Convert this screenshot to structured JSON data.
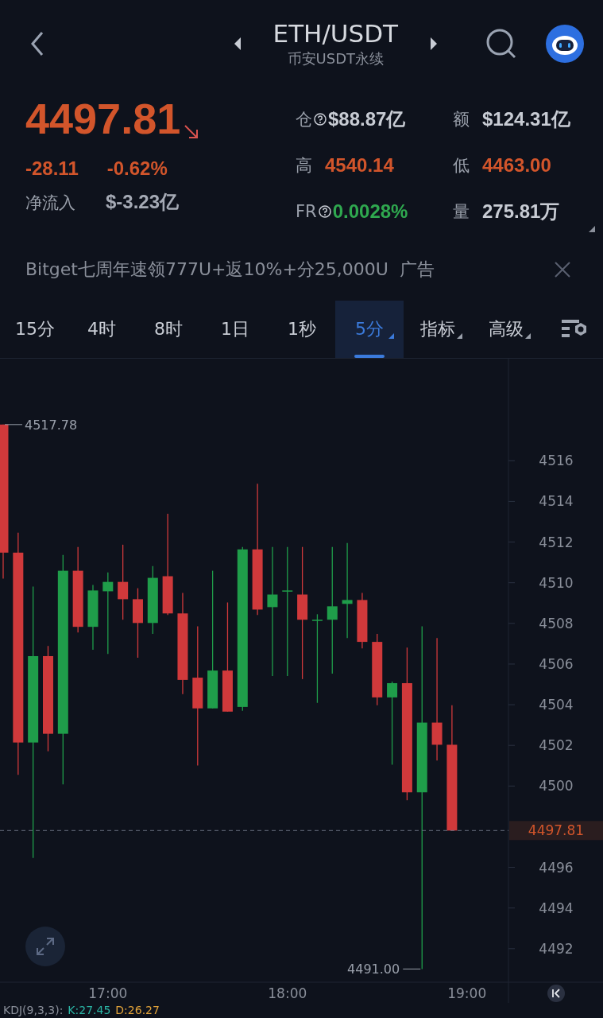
{
  "header": {
    "title": "ETH/USDT",
    "subtitle": "币安USDT永续"
  },
  "quote": {
    "price": "4497.81",
    "change": "-28.11",
    "change_pct": "-0.62%",
    "netflow_label": "净流入",
    "netflow": "$-3.23亿"
  },
  "stats": [
    {
      "label": "仓",
      "help": true,
      "value": "$88.87亿",
      "color": "#c8ccd4"
    },
    {
      "label": "额",
      "help": false,
      "value": "$124.31亿",
      "color": "#c8ccd4"
    },
    {
      "label": "高",
      "help": false,
      "value": "4540.14",
      "color": "#d2552b"
    },
    {
      "label": "低",
      "help": false,
      "value": "4463.00",
      "color": "#d2552b"
    },
    {
      "label": "FR",
      "help": true,
      "value": "0.0028%",
      "color": "#2fa84f"
    },
    {
      "label": "量",
      "help": false,
      "value": "275.81万",
      "color": "#c8ccd4"
    }
  ],
  "ad": {
    "text": "Bitget七周年速领777U+返10%+分25,000U",
    "tag": "广告"
  },
  "tabs": [
    {
      "label": "15分",
      "selected": false,
      "dropdown": false
    },
    {
      "label": "4时",
      "selected": false,
      "dropdown": false
    },
    {
      "label": "8时",
      "selected": false,
      "dropdown": false
    },
    {
      "label": "1日",
      "selected": false,
      "dropdown": false
    },
    {
      "label": "1秒",
      "selected": false,
      "dropdown": false
    },
    {
      "label": "5分",
      "selected": true,
      "dropdown": true
    },
    {
      "label": "指标",
      "selected": false,
      "dropdown": true
    },
    {
      "label": "高级",
      "selected": false,
      "dropdown": true
    }
  ],
  "chart": {
    "high_label": "4517.78",
    "low_label": "4491.00",
    "chart_data": {
      "type": "candlestick",
      "categories": [
        null,
        null,
        null,
        null,
        null,
        null,
        null,
        "17:00",
        null,
        null,
        null,
        null,
        null,
        null,
        null,
        null,
        null,
        null,
        null,
        "18:00",
        null,
        null,
        null,
        null,
        null,
        null,
        null,
        null,
        null,
        null,
        null,
        "19:00"
      ],
      "ohlc": [
        [
          4517.78,
          4517.78,
          4510.2,
          4511.48
        ],
        [
          4511.48,
          4512.46,
          4500.55,
          4502.14
        ],
        [
          4502.14,
          4509.81,
          4496.46,
          4506.39
        ],
        [
          4506.39,
          4506.89,
          4501.71,
          4502.57
        ],
        [
          4502.57,
          4511.37,
          4500.08,
          4510.59
        ],
        [
          4510.59,
          4511.76,
          4507.55,
          4507.83
        ],
        [
          4507.83,
          4509.89,
          4506.7,
          4509.62
        ],
        [
          4509.58,
          4510.51,
          4506.5,
          4510.04
        ],
        [
          4510.04,
          4511.87,
          4508.18,
          4509.19
        ],
        [
          4509.19,
          4509.73,
          4506.31,
          4508.02
        ],
        [
          4508.02,
          4510.82,
          4507.48,
          4510.24
        ],
        [
          4510.32,
          4513.39,
          4508.41,
          4508.49
        ],
        [
          4508.49,
          4509.5,
          4504.52,
          4505.22
        ],
        [
          4505.33,
          4507.86,
          4501.01,
          4503.82
        ],
        [
          4503.82,
          4510.59,
          4503.82,
          4505.68
        ],
        [
          4505.68,
          4509.03,
          4503.66,
          4503.66
        ],
        [
          4503.89,
          4511.76,
          4503.7,
          4511.64
        ],
        [
          4511.64,
          4514.87,
          4508.41,
          4508.68
        ],
        [
          4508.8,
          4511.76,
          4505.41,
          4509.42
        ],
        [
          4509.62,
          4511.76,
          4505.41,
          4509.62
        ],
        [
          4509.42,
          4511.76,
          4505.26,
          4508.18
        ],
        [
          4508.18,
          4508.45,
          4504.09,
          4508.18
        ],
        [
          4508.18,
          4511.76,
          4505.53,
          4508.84
        ],
        [
          4508.96,
          4511.95,
          4507.28,
          4509.15
        ],
        [
          4509.15,
          4509.5,
          4506.77,
          4507.09
        ],
        [
          4507.09,
          4507.48,
          4503.97,
          4504.36
        ],
        [
          4504.36,
          4505.14,
          4501.05,
          4505.06
        ],
        [
          4505.06,
          4506.81,
          4499.3,
          4499.69
        ],
        [
          4499.69,
          4507.86,
          4491.0,
          4503.12
        ],
        [
          4503.12,
          4507.28,
          4501.25,
          4502.03
        ],
        [
          4502.03,
          4503.97,
          4497.81,
          4497.81
        ],
        null
      ],
      "ylim": [
        4490.35,
        4521.02
      ],
      "yticks": [
        4492,
        4494,
        4496,
        4500,
        4502,
        4504,
        4506,
        4508,
        4510,
        4512,
        4514,
        4516
      ],
      "ref_lines": [
        {
          "axis": "y",
          "value": 4497.81,
          "label": "4497.81"
        }
      ]
    }
  },
  "indicator": [
    {
      "text": "KDJ(9,3,3):",
      "color": "#8a8f9a"
    },
    {
      "text": "K:27.45",
      "color": "#2bb5a5"
    },
    {
      "text": "D:26.27",
      "color": "#e0a23a"
    }
  ]
}
